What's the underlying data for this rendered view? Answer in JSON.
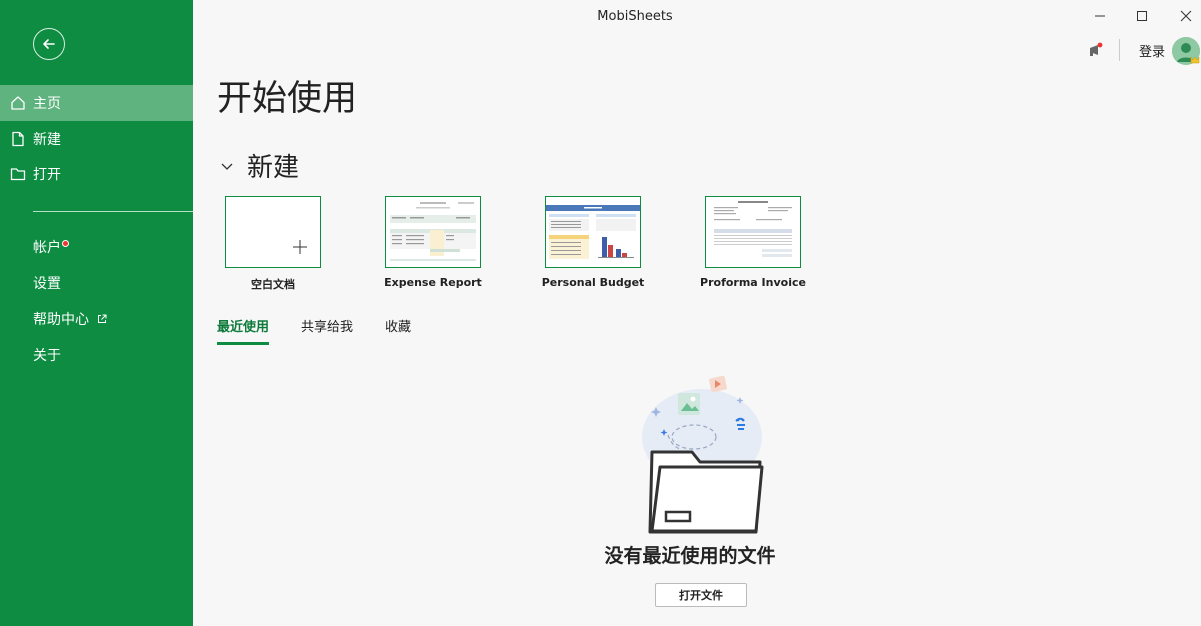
{
  "window": {
    "title": "MobiSheets"
  },
  "sidebar": {
    "items": [
      {
        "label": "主页",
        "icon": "home-icon",
        "active": true
      },
      {
        "label": "新建",
        "icon": "new-document-icon",
        "active": false
      },
      {
        "label": "打开",
        "icon": "folder-icon",
        "active": false
      }
    ],
    "sub_items": [
      {
        "label": "帐户",
        "badge": "red-dot"
      },
      {
        "label": "设置"
      },
      {
        "label": "帮助中心",
        "icon": "external-link-icon"
      },
      {
        "label": "关于"
      }
    ],
    "background": "#0d8c42",
    "active_color": "#5fb37e"
  },
  "header": {
    "page_title": "开始使用",
    "login_label": "登录"
  },
  "new_section": {
    "title": "新建",
    "templates": [
      {
        "name": "空白文档",
        "kind": "blank"
      },
      {
        "name": "Expense Report",
        "kind": "expense"
      },
      {
        "name": "Personal Budget",
        "kind": "budget"
      },
      {
        "name": "Proforma Invoice",
        "kind": "invoice"
      }
    ]
  },
  "tabs": [
    {
      "label": "最近使用",
      "active": true
    },
    {
      "label": "共享给我",
      "active": false
    },
    {
      "label": "收藏",
      "active": false
    }
  ],
  "empty_state": {
    "message": "没有最近使用的文件",
    "button_label": "打开文件"
  }
}
